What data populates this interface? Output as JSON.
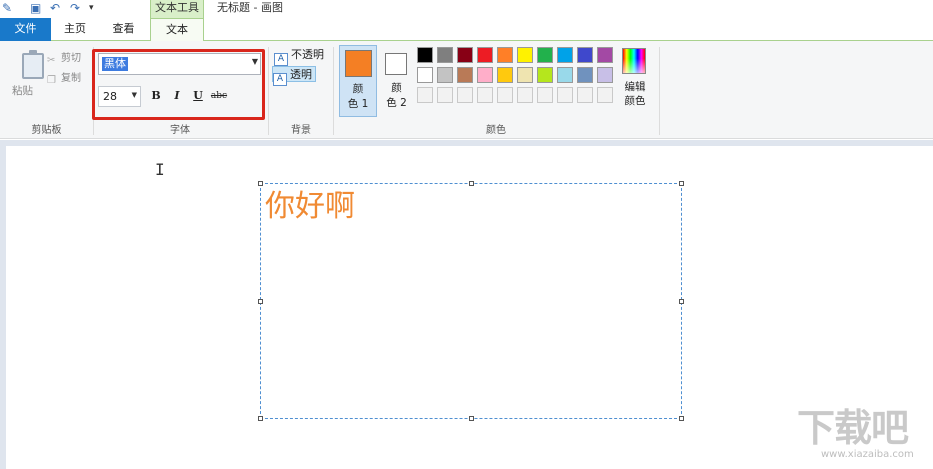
{
  "window": {
    "context_tab_label": "文本工具",
    "title": "无标题 - 画图"
  },
  "tabs": [
    {
      "label": "文件"
    },
    {
      "label": "主页"
    },
    {
      "label": "查看"
    },
    {
      "label": "文本"
    }
  ],
  "clipboard": {
    "paste": "粘贴",
    "cut": "剪切",
    "copy": "复制",
    "group": "剪贴板"
  },
  "font": {
    "family": "黑体",
    "size": "28",
    "bold": "B",
    "italic": "I",
    "underline": "U",
    "strikethrough": "abc",
    "group": "字体"
  },
  "background": {
    "opaque": "不透明",
    "transparent": "透明",
    "selected": "透明",
    "group": "背景"
  },
  "colors": {
    "color1_label_line1": "颜",
    "color1_label_line2": "色 1",
    "color2_label_line1": "颜",
    "color2_label_line2": "色 2",
    "color1": "#f47f24",
    "color2": "#ffffff",
    "edit_line1": "编辑",
    "edit_line2": "颜色",
    "group": "颜色",
    "palette_row1": [
      "#000000",
      "#7f7f7f",
      "#880015",
      "#ed1c24",
      "#ff7f27",
      "#fff200",
      "#22b14c",
      "#00a2e8",
      "#3f48cc",
      "#a349a4"
    ],
    "palette_row2": [
      "#ffffff",
      "#c3c3c3",
      "#b97a57",
      "#ffaec9",
      "#ffc90e",
      "#efe4b0",
      "#b5e61d",
      "#99d9ea",
      "#7092be",
      "#c8bfe7"
    ],
    "palette_row3_count": 10
  },
  "canvas": {
    "text": "你好啊",
    "text_color": "#f08a33"
  },
  "watermark": {
    "main": "下载吧",
    "url": "www.xiazaiba.com"
  }
}
